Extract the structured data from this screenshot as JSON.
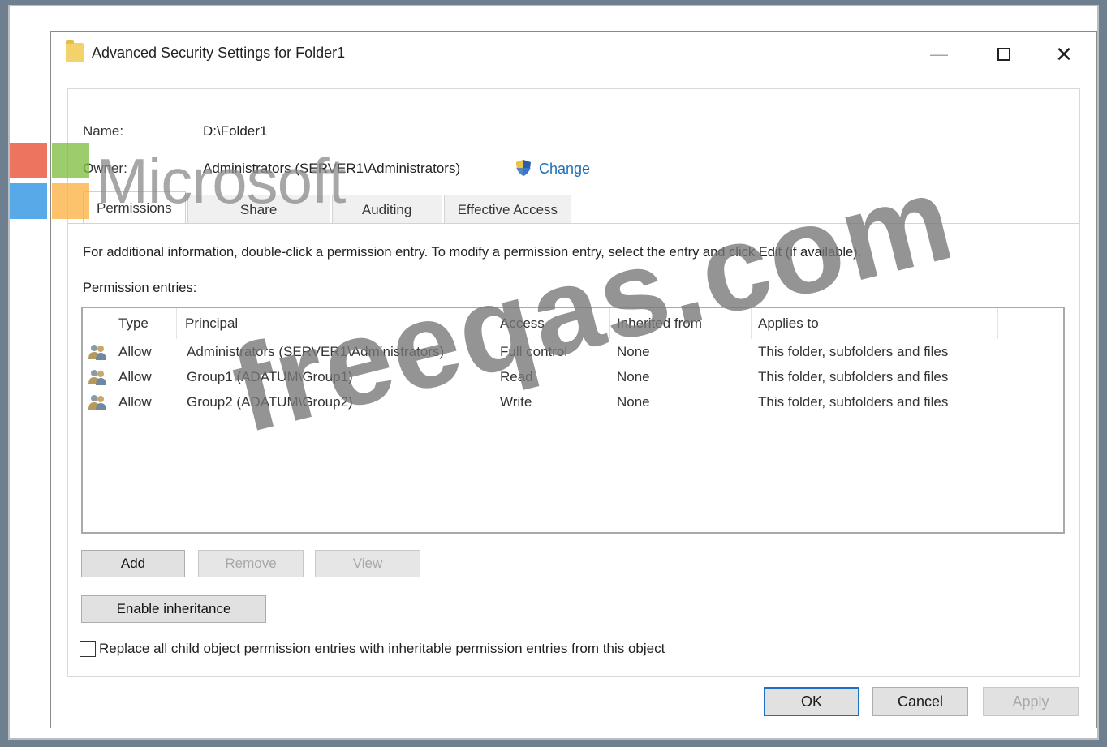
{
  "window": {
    "title": "Advanced Security Settings for Folder1",
    "minimize": "—",
    "close": "✕"
  },
  "fields": {
    "name_label": "Name:",
    "name_value": "D:\\Folder1",
    "owner_label": "Owner:",
    "owner_value": "Administrators (SERVER1\\Administrators)",
    "change_link": "Change"
  },
  "tabs": [
    {
      "label": "Permissions",
      "active": true
    },
    {
      "label": "Share",
      "active": false
    },
    {
      "label": "Auditing",
      "active": false
    },
    {
      "label": "Effective Access",
      "active": false
    }
  ],
  "info_text": "For additional information, double-click a permission entry. To modify a permission entry, select the entry and click Edit (if available).",
  "entries_label": "Permission entries:",
  "table": {
    "columns": [
      "Type",
      "Principal",
      "Access",
      "Inherited from",
      "Applies to"
    ],
    "rows": [
      {
        "type": "Allow",
        "principal": "Administrators (SERVER1\\Administrators)",
        "access": "Full control",
        "inherited": "None",
        "applies": "This folder, subfolders and files"
      },
      {
        "type": "Allow",
        "principal": "Group1 (ADATUM\\Group1)",
        "access": "Read",
        "inherited": "None",
        "applies": "This folder, subfolders and files"
      },
      {
        "type": "Allow",
        "principal": "Group2 (ADATUM\\Group2)",
        "access": "Write",
        "inherited": "None",
        "applies": "This folder, subfolders and files"
      }
    ]
  },
  "buttons": {
    "add": "Add",
    "remove": "Remove",
    "view": "View",
    "enable_inheritance": "Enable inheritance",
    "ok": "OK",
    "cancel": "Cancel",
    "apply": "Apply"
  },
  "replace_checkbox": {
    "label": "Replace all child object permission entries with inheritable permission entries from this object",
    "checked": false
  },
  "watermarks": {
    "microsoft": "Microsoft",
    "site": "freeqas.com"
  },
  "colors": {
    "link": "#1e6fb8",
    "ms_red": "#e8482c",
    "ms_green": "#7cbb3a",
    "ms_blue": "#1f8ee0",
    "ms_yellow": "#fbb03b"
  }
}
